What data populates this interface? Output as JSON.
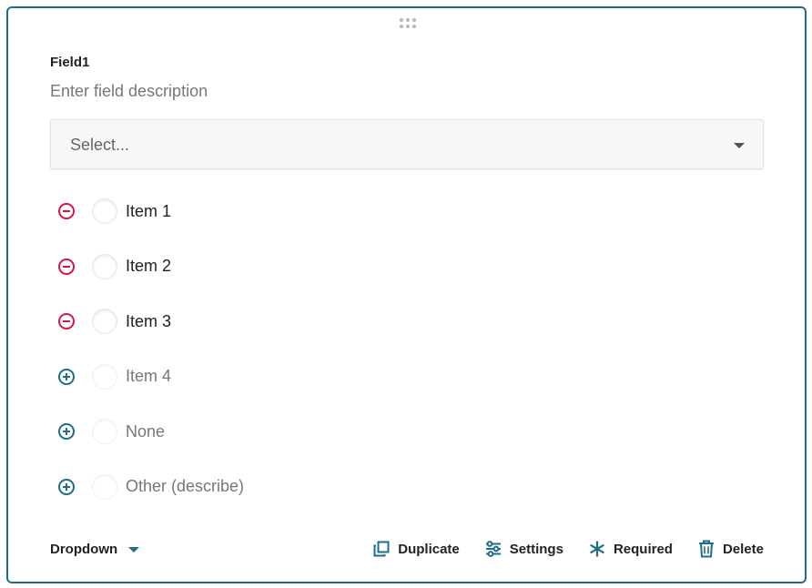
{
  "field": {
    "title": "Field1",
    "description_placeholder": "Enter field description"
  },
  "select": {
    "placeholder": "Select..."
  },
  "options": [
    {
      "label": "Item 1",
      "state": "active",
      "control": "remove"
    },
    {
      "label": "Item 2",
      "state": "active",
      "control": "remove"
    },
    {
      "label": "Item 3",
      "state": "active",
      "control": "remove"
    },
    {
      "label": "Item 4",
      "state": "inactive",
      "control": "add"
    },
    {
      "label": "None",
      "state": "inactive",
      "control": "add"
    },
    {
      "label": "Other (describe)",
      "state": "inactive",
      "control": "add"
    }
  ],
  "footer": {
    "field_type": "Dropdown",
    "actions": {
      "duplicate": "Duplicate",
      "settings": "Settings",
      "required": "Required",
      "delete": "Delete"
    }
  },
  "colors": {
    "accent": "#1f6d86",
    "remove": "#d0164a",
    "add": "#1f6d86"
  },
  "icons": {
    "remove": "minus-circle-icon",
    "add": "plus-circle-icon",
    "duplicate": "duplicate-icon",
    "settings": "sliders-icon",
    "required": "asterisk-icon",
    "delete": "trash-icon",
    "drag": "drag-handle-icon"
  }
}
